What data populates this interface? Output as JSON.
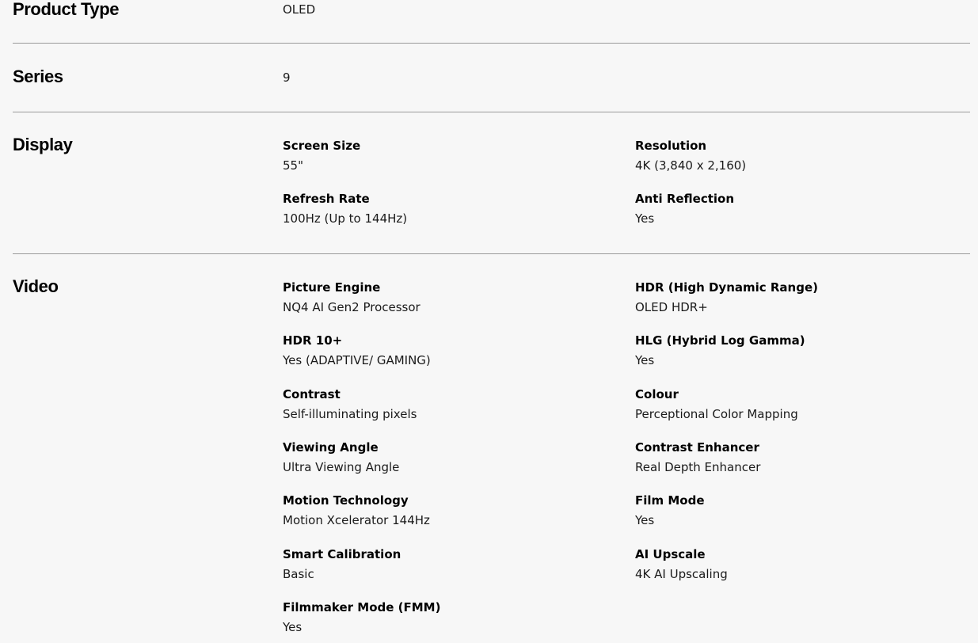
{
  "sections": {
    "product_type": {
      "title": "Product Type",
      "value": "OLED"
    },
    "series": {
      "title": "Series",
      "value": "9"
    },
    "display": {
      "title": "Display",
      "specs": [
        {
          "label": "Screen Size",
          "value": "55\""
        },
        {
          "label": "Resolution",
          "value": "4K (3,840 x 2,160)"
        },
        {
          "label": "Refresh Rate",
          "value": "100Hz (Up to 144Hz)"
        },
        {
          "label": "Anti Reflection",
          "value": "Yes"
        }
      ]
    },
    "video": {
      "title": "Video",
      "specs": [
        {
          "label": "Picture Engine",
          "value": "NQ4 AI Gen2 Processor"
        },
        {
          "label": "HDR (High Dynamic Range)",
          "value": "OLED HDR+"
        },
        {
          "label": "HDR 10+",
          "value": "Yes (ADAPTIVE/ GAMING)"
        },
        {
          "label": "HLG (Hybrid Log Gamma)",
          "value": "Yes"
        },
        {
          "label": "Contrast",
          "value": "Self-illuminating pixels"
        },
        {
          "label": "Colour",
          "value": "Perceptional Color Mapping"
        },
        {
          "label": "Viewing Angle",
          "value": "Ultra Viewing Angle"
        },
        {
          "label": "Contrast Enhancer",
          "value": "Real Depth Enhancer"
        },
        {
          "label": "Motion Technology",
          "value": "Motion Xcelerator 144Hz"
        },
        {
          "label": "Film Mode",
          "value": "Yes"
        },
        {
          "label": "Smart Calibration",
          "value": "Basic"
        },
        {
          "label": "AI Upscale",
          "value": "4K AI Upscaling"
        },
        {
          "label": "Filmmaker Mode (FMM)",
          "value": "Yes"
        }
      ]
    }
  }
}
